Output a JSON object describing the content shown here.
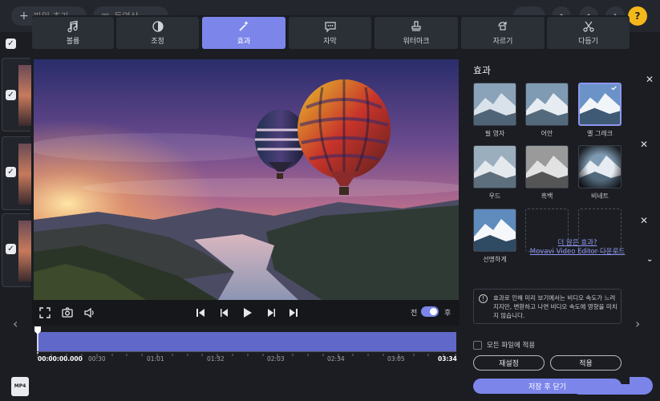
{
  "background": {
    "add_files_label": "파일 추가",
    "format_label": "동영상",
    "add_count": "1",
    "format_tag": "MP4"
  },
  "tabs": [
    {
      "label": "볼륨",
      "icon": "music-note-icon"
    },
    {
      "label": "조정",
      "icon": "contrast-icon"
    },
    {
      "label": "효과",
      "icon": "magic-wand-icon",
      "active": true
    },
    {
      "label": "자막",
      "icon": "speech-bubble-icon"
    },
    {
      "label": "워터마크",
      "icon": "stamp-icon"
    },
    {
      "label": "자르기",
      "icon": "crop-rotate-icon"
    },
    {
      "label": "다듬기",
      "icon": "scissors-icon"
    }
  ],
  "player": {
    "before_label": "전",
    "after_label": "후"
  },
  "timeline": {
    "current_time": "00:00:00.000",
    "ticks": [
      "00:30",
      "01:01",
      "01:32",
      "02:03",
      "02:34",
      "03:05"
    ],
    "end_time": "03:34"
  },
  "effects_panel": {
    "title": "효과",
    "effects": [
      {
        "label": "필 영자",
        "filter": "sepia"
      },
      {
        "label": "어안",
        "filter": "fisheye"
      },
      {
        "label": "옐 그레크",
        "filter": "vivid",
        "selected": true
      },
      {
        "label": "우드",
        "filter": "warm"
      },
      {
        "label": "흑백",
        "filter": "grayscale"
      },
      {
        "label": "비네트",
        "filter": "vignette"
      },
      {
        "label": "선명하게",
        "filter": "sharpen"
      }
    ],
    "more_effects_line1": "더 많은 효과?",
    "more_effects_line2": "Movavi Video Editor 다운로드",
    "notice": "효과로 인해 미리 보기에서는 비디오 속도가 느려지지만, 변환하고 나면 비디오 속도에 영향을 미치지 않습니다.",
    "apply_all_label": "모든 파일에 적용",
    "reset_label": "재설정",
    "apply_label": "적용",
    "save_close_label": "저장 후 닫기"
  },
  "colors": {
    "accent": "#7c86ea",
    "help": "#f3b81a",
    "background": "#1b1d22"
  }
}
